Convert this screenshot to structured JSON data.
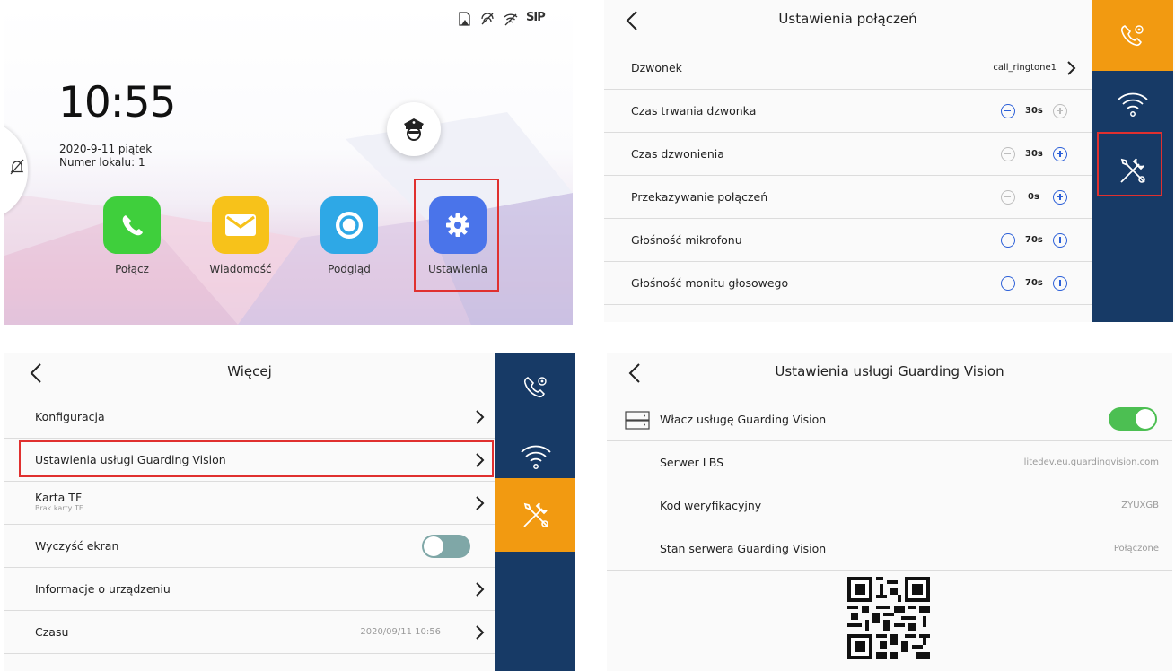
{
  "home": {
    "status_icons": [
      "sd-card-icon",
      "network-icon",
      "wifi-icon",
      "sip-icon"
    ],
    "sip_label": "SIP",
    "time": "10:55",
    "date": "2020-9-11 piątek",
    "room": "Numer lokalu: 1",
    "apps": [
      {
        "label": "Połącz",
        "color": "#3fcf3c"
      },
      {
        "label": "Wiadomość",
        "color": "#f7c21a"
      },
      {
        "label": "Podgląd",
        "color": "#2ea8e6"
      },
      {
        "label": "Ustawienia",
        "color": "#4a74ea"
      }
    ]
  },
  "call_settings": {
    "title": "Ustawienia połączeń",
    "rows": [
      {
        "label": "Dzwonek",
        "value": "call_ringtone1"
      },
      {
        "label": "Czas trwania dzwonka",
        "value": "30s"
      },
      {
        "label": "Czas dzwonienia",
        "value": "30s"
      },
      {
        "label": "Przekazywanie połączeń",
        "value": "0s"
      },
      {
        "label": "Głośność mikrofonu",
        "value": "70s"
      },
      {
        "label": "Głośność monitu głosowego",
        "value": "70s"
      }
    ]
  },
  "more": {
    "title": "Więcej",
    "rows": [
      {
        "label": "Konfiguracja"
      },
      {
        "label": "Ustawienia usługi Guarding Vision"
      },
      {
        "label": "Karta TF",
        "sub": "Brak karty TF."
      },
      {
        "label": "Wyczyść ekran"
      },
      {
        "label": "Informacje o urządzeniu"
      },
      {
        "label": "Czasu",
        "value": "2020/09/11 10:56"
      }
    ]
  },
  "guarding": {
    "title": "Ustawienia usługi Guarding Vision",
    "enable_label": "Włacz usługę Guarding Vision",
    "rows": [
      {
        "label": "Serwer LBS",
        "value": "litedev.eu.guardingvision.com"
      },
      {
        "label": "Kod weryfikacyjny",
        "value": "ZYUXGB"
      },
      {
        "label": "Stan serwera Guarding Vision",
        "value": "Połączone"
      }
    ]
  },
  "colors": {
    "accent_orange": "#f29a11",
    "rail_navy": "#173a66",
    "highlight_red": "#e0302f",
    "toggle_green": "#4cbf52",
    "toggle_grey": "#7fa7a7",
    "stepper_blue": "#2b5fd8"
  }
}
